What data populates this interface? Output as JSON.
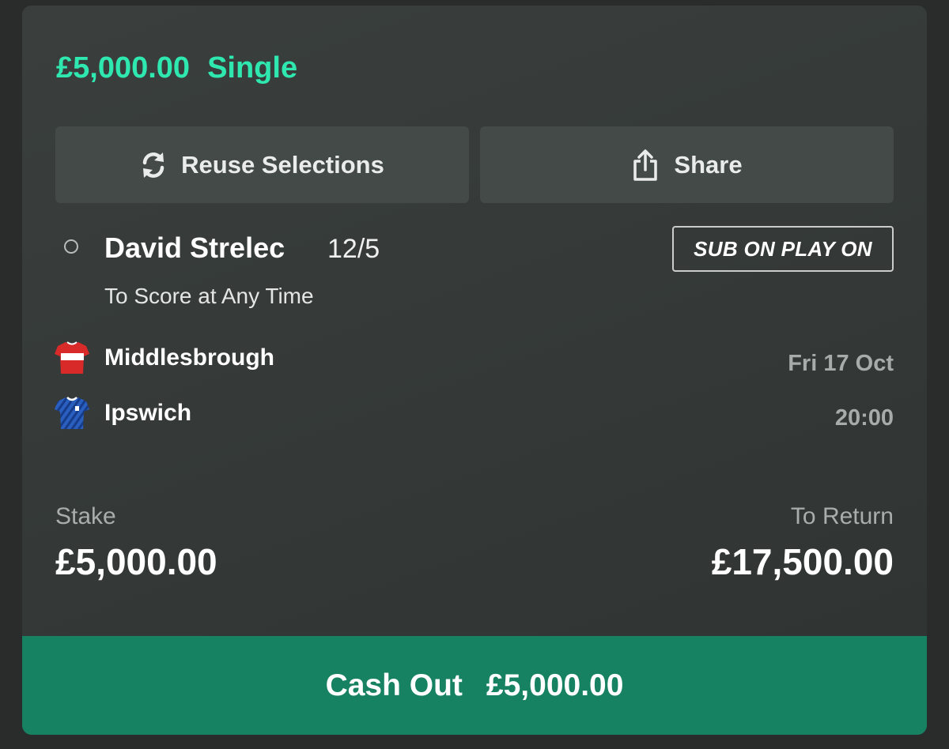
{
  "bet": {
    "stake_header": "£5,000.00",
    "type": "Single"
  },
  "actions": {
    "reuse_label": "Reuse Selections",
    "share_label": "Share"
  },
  "selection": {
    "name": "David Strelec",
    "odds": "12/5",
    "market": "To Score at Any Time",
    "promo_badge": "SUB ON PLAY ON"
  },
  "event": {
    "home_team": "Middlesbrough",
    "away_team": "Ipswich",
    "date": "Fri 17 Oct",
    "time": "20:00"
  },
  "summary": {
    "stake_label": "Stake",
    "stake_value": "£5,000.00",
    "return_label": "To Return",
    "return_value": "£17,500.00"
  },
  "cashout": {
    "label": "Cash Out",
    "value": "£5,000.00"
  },
  "colors": {
    "accent": "#2ee8b0",
    "cashout_bg": "#178262",
    "card_bg": "#363b39",
    "button_bg": "#434a48"
  },
  "icons": {
    "reuse": "refresh-icon",
    "share": "share-icon",
    "home_shirt": "middlesbrough-shirt-icon",
    "away_shirt": "ipswich-shirt-icon"
  }
}
